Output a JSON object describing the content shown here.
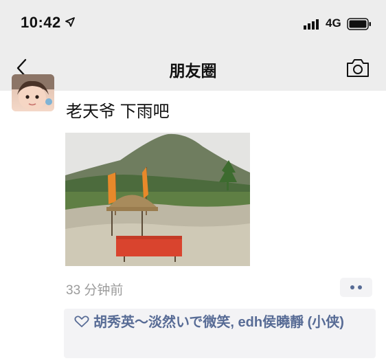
{
  "status_bar": {
    "time": "10:42",
    "network": "4G",
    "icons": [
      "location-arrow-icon",
      "signal-icon",
      "battery-icon"
    ]
  },
  "nav": {
    "title": "朋友圈",
    "back_icon": "chevron-left-icon",
    "camera_icon": "camera-icon"
  },
  "post": {
    "text": "老天爷 下雨吧",
    "timestamp": "33 分钟前",
    "more_icon": "more-dots-icon",
    "likes_icon": "heart-outline-icon",
    "likes_text": "胡秀英～淡然いで微笑, edh侯曉靜 (小侠)"
  },
  "colors": {
    "bar_bg": "#ededed",
    "link_blue": "#576b95",
    "timestamp_gray": "#9b9b9b",
    "likes_bg": "#f3f3f5"
  }
}
